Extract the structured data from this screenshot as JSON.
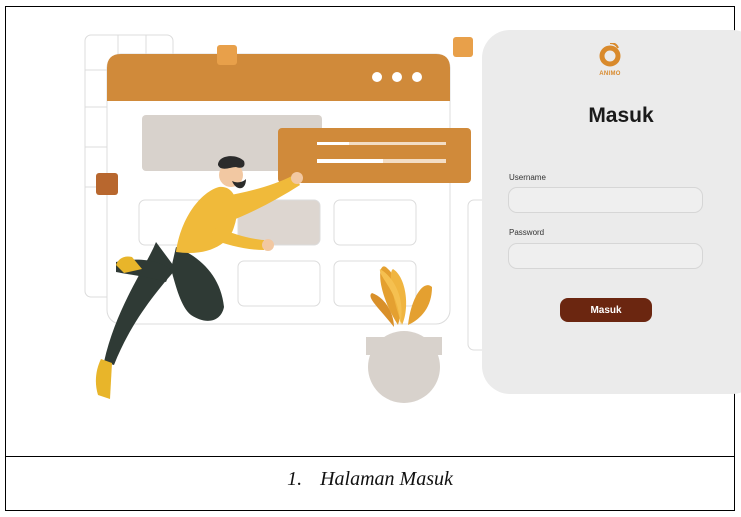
{
  "login": {
    "brand": "ANIMO",
    "title": "Masuk",
    "username_label": "Username",
    "username_value": "",
    "password_label": "Password",
    "password_value": "",
    "submit_label": "Masuk"
  },
  "caption": {
    "number": "1.",
    "text": "Halaman Masuk"
  },
  "colors": {
    "accent_orange": "#d98a2c",
    "button_brown": "#6b2610",
    "card_bg": "#ebebeb"
  }
}
